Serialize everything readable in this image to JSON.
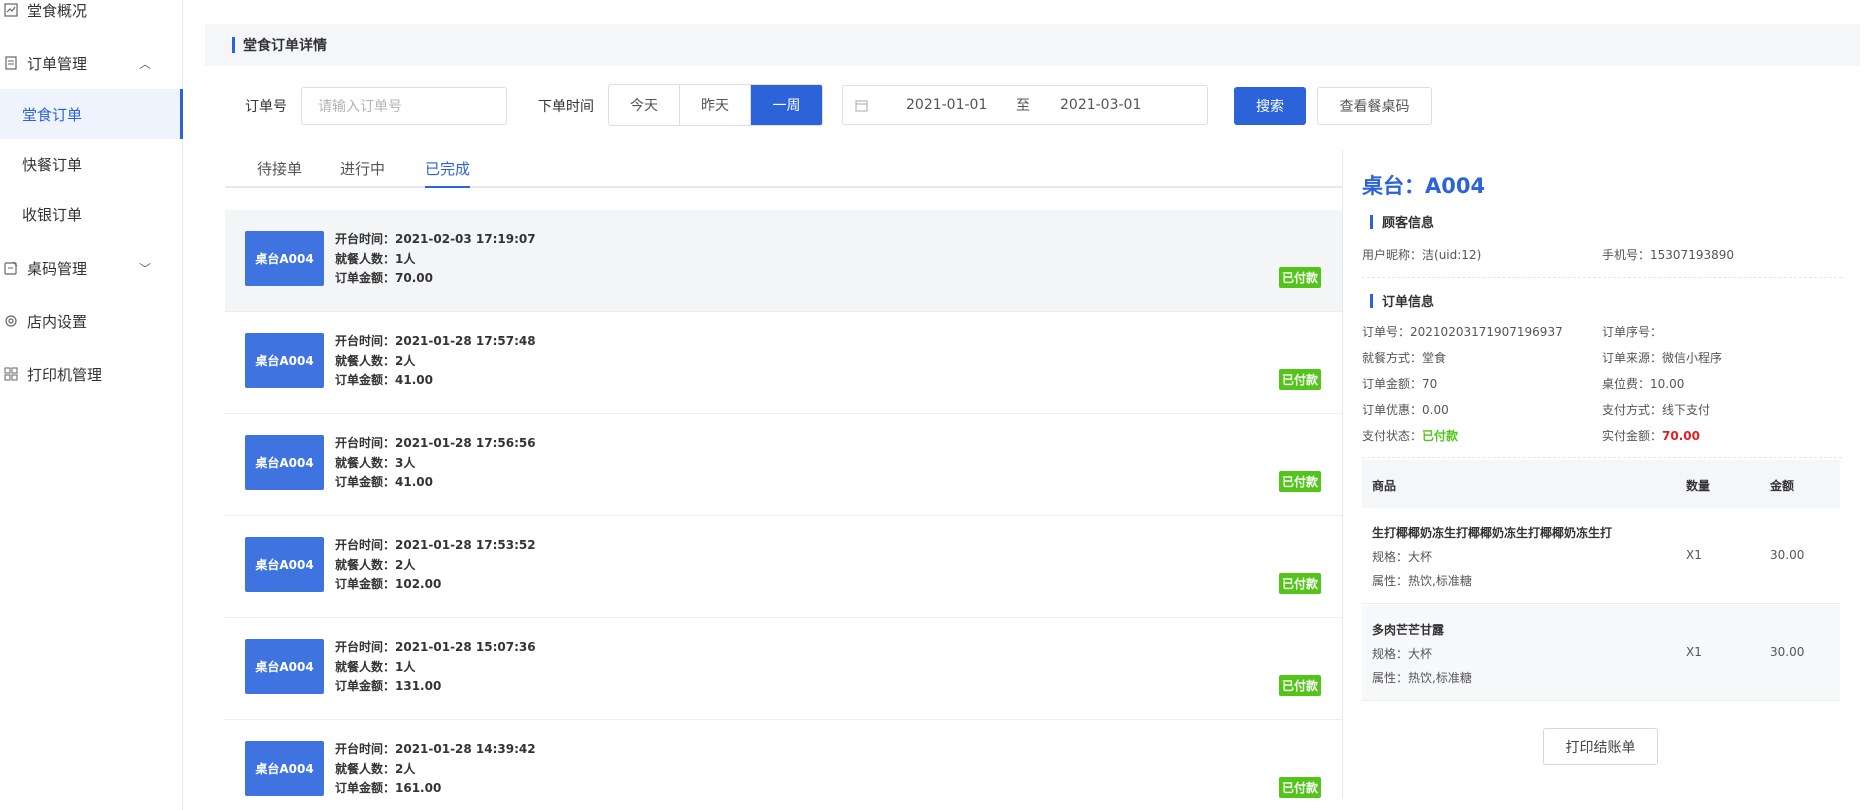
{
  "sidebar": {
    "items": [
      {
        "label": "堂食概况",
        "icon": "chart-icon"
      },
      {
        "label": "订单管理",
        "icon": "document-icon"
      },
      {
        "label": "桌码管理",
        "icon": "qrcode-icon"
      },
      {
        "label": "店内设置",
        "icon": "gear-icon"
      },
      {
        "label": "打印机管理",
        "icon": "grid-icon"
      }
    ],
    "sub_items": [
      "堂食订单",
      "快餐订单",
      "收银订单"
    ]
  },
  "header": {
    "title": "堂食订单详情"
  },
  "filters": {
    "order_no_label": "订单号",
    "order_no_placeholder": "请输入订单号",
    "time_label": "下单时间",
    "time_options": [
      "今天",
      "昨天",
      "一周"
    ],
    "selected_time": "一周",
    "date_start": "2021-01-01",
    "date_sep": "至",
    "date_end": "2021-03-01",
    "search_label": "搜索",
    "view_code_label": "查看餐桌码"
  },
  "tabs": [
    "待接单",
    "进行中",
    "已完成"
  ],
  "active_tab": "已完成",
  "orders": [
    {
      "table": "桌台A004",
      "time": "开台时间：2021-02-03 17:19:07",
      "people": "就餐人数：1人",
      "amount": "订单金额：70.00",
      "status": "已付款"
    },
    {
      "table": "桌台A004",
      "time": "开台时间：2021-01-28 17:57:48",
      "people": "就餐人数：2人",
      "amount": "订单金额：41.00",
      "status": "已付款"
    },
    {
      "table": "桌台A004",
      "time": "开台时间：2021-01-28 17:56:56",
      "people": "就餐人数：3人",
      "amount": "订单金额：41.00",
      "status": "已付款"
    },
    {
      "table": "桌台A004",
      "time": "开台时间：2021-01-28 17:53:52",
      "people": "就餐人数：2人",
      "amount": "订单金额：102.00",
      "status": "已付款"
    },
    {
      "table": "桌台A004",
      "time": "开台时间：2021-01-28 15:07:36",
      "people": "就餐人数：1人",
      "amount": "订单金额：131.00",
      "status": "已付款"
    },
    {
      "table": "桌台A004",
      "time": "开台时间：2021-01-28 14:39:42",
      "people": "就餐人数：2人",
      "amount": "订单金额：161.00",
      "status": "已付款"
    }
  ],
  "detail": {
    "title": "桌台：A004",
    "customer_header": "顾客信息",
    "nickname_label": "用户昵称：",
    "nickname_value": "洁(uid:12)",
    "phone_label": "手机号：",
    "phone_value": "15307193890",
    "order_header": "订单信息",
    "order_no_label": "订单号：",
    "order_no_value": "20210203171907196937",
    "seq_label": "订单序号：",
    "seq_value": "",
    "dine_label": "就餐方式：",
    "dine_value": "堂食",
    "source_label": "订单来源：",
    "source_value": "微信小程序",
    "amount_label": "订单金额：",
    "amount_value": "70",
    "seat_fee_label": "桌位费：",
    "seat_fee_value": "10.00",
    "discount_label": "订单优惠：",
    "discount_value": "0.00",
    "pay_method_label": "支付方式：",
    "pay_method_value": "线下支付",
    "pay_status_label": "支付状态：",
    "pay_status_value": "已付款",
    "paid_label": "实付金额：",
    "paid_value": "70.00",
    "goods_headers": [
      "商品",
      "数量",
      "金额"
    ],
    "goods": [
      {
        "name": "生打椰椰奶冻生打椰椰奶冻生打椰椰奶冻生打",
        "spec": "规格：大杯",
        "attr": "属性：热饮,标准糖",
        "qty": "X1",
        "amount": "30.00"
      },
      {
        "name": "多肉芒芒甘露",
        "spec": "规格：大杯",
        "attr": "属性：热饮,标准糖",
        "qty": "X1",
        "amount": "30.00"
      }
    ],
    "print_label": "打印结账单"
  },
  "colors": {
    "accent": "#2c63d8",
    "paid_badge": "#52c41a",
    "paid_amount": "#e02020"
  }
}
